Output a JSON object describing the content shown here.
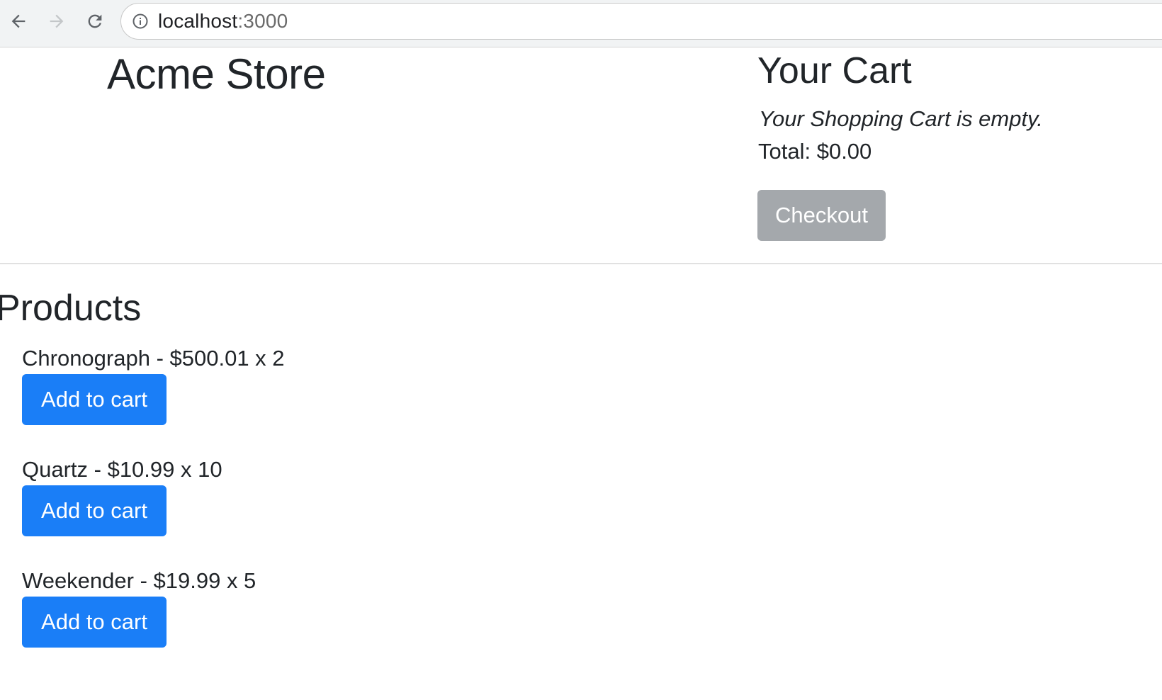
{
  "browser": {
    "url_host": "localhost",
    "url_port": ":3000",
    "back_icon": "arrow-left-icon",
    "forward_icon": "arrow-right-icon",
    "reload_icon": "reload-icon",
    "info_icon": "info-circle-icon"
  },
  "store": {
    "title": "Acme Store"
  },
  "cart": {
    "title": "Your Cart",
    "empty_message": "Your Shopping Cart is empty.",
    "total_label": "Total: $0.00",
    "checkout_label": "Checkout"
  },
  "products": {
    "title": "Products",
    "items": [
      {
        "label": "Chronograph - $500.01 x 2",
        "button": "Add to cart"
      },
      {
        "label": "Quartz - $10.99 x 10",
        "button": "Add to cart"
      },
      {
        "label": "Weekender - $19.99 x 5",
        "button": "Add to cart"
      }
    ]
  },
  "colors": {
    "primary": "#1a7ef7",
    "disabled": "#a4a8ac",
    "text": "#212529"
  }
}
